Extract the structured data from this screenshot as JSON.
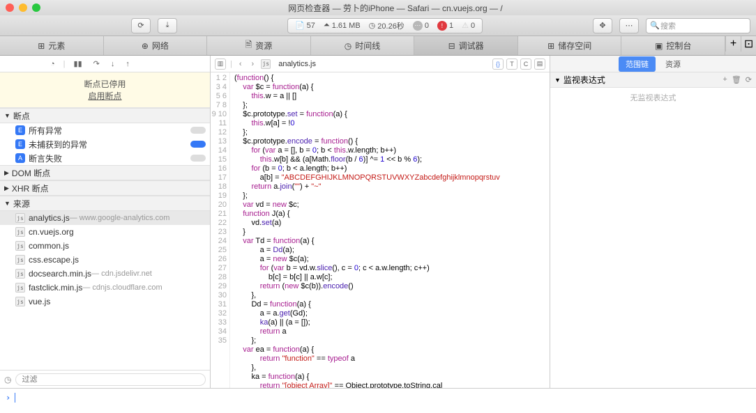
{
  "title": "网页检查器 — 劳卜的iPhone — Safari — cn.vuejs.org — /",
  "toolbar": {
    "files": "57",
    "size": "1.61 MB",
    "time": "20.26秒",
    "msgs": "0",
    "errors": "1",
    "warnings": "0",
    "search_ph": "搜索"
  },
  "tabs": [
    "元素",
    "网络",
    "资源",
    "时间线",
    "调试器",
    "储存空间",
    "控制台"
  ],
  "left": {
    "notice_title": "断点已停用",
    "notice_link": "启用断点",
    "sections": {
      "breakpoints": "断点",
      "dom": "DOM 断点",
      "xhr": "XHR 断点",
      "sources": "来源"
    },
    "bp_rows": [
      "所有异常",
      "未捕获到的异常",
      "断言失败"
    ],
    "sources": [
      {
        "name": "analytics.js",
        "host": " — www.google-analytics.com"
      },
      {
        "name": "cn.vuejs.org",
        "host": ""
      },
      {
        "name": "common.js",
        "host": ""
      },
      {
        "name": "css.escape.js",
        "host": ""
      },
      {
        "name": "docsearch.min.js",
        "host": " — cdn.jsdelivr.net"
      },
      {
        "name": "fastclick.min.js",
        "host": " — cdnjs.cloudflare.com"
      },
      {
        "name": "vue.js",
        "host": ""
      }
    ],
    "filter_ph": "过滤"
  },
  "mid": {
    "file": "analytics.js",
    "lines": 35
  },
  "code": {
    "l1a": "(",
    "l1b": "function",
    "l1c": "() {",
    "l2a": "    ",
    "l2b": "var",
    "l2c": " $c = ",
    "l2d": "function",
    "l2e": "(a) {",
    "l3a": "        ",
    "l3b": "this",
    "l3c": ".w = a || []",
    "l4": "    };",
    "l5a": "    $c.prototype.",
    "l5b": "set",
    "l5c": " = ",
    "l5d": "function",
    "l5e": "(a) {",
    "l6a": "        ",
    "l6b": "this",
    "l6c": ".w[a] = !",
    "l6d": "0",
    "l7": "    };",
    "l8a": "    $c.prototype.",
    "l8b": "encode",
    "l8c": " = ",
    "l8d": "function",
    "l8e": "() {",
    "l9a": "        ",
    "l9b": "for",
    "l9c": " (",
    "l9d": "var",
    "l9e": " a = [], b = ",
    "l9f": "0",
    "l9g": "; b < ",
    "l9h": "this",
    "l9i": ".w.length; b++)",
    "l10a": "            ",
    "l10b": "this",
    "l10c": ".w[b] && (a[Math.",
    "l10d": "floor",
    "l10e": "(b / ",
    "l10f": "6",
    "l10g": ")] ^= ",
    "l10h": "1",
    "l10i": " << b % ",
    "l10j": "6",
    "l10k": ");",
    "l11a": "        ",
    "l11b": "for",
    "l11c": " (b = ",
    "l11d": "0",
    "l11e": "; b < a.length; b++)",
    "l12a": "            a[b] = ",
    "l12b": "\"ABCDEFGHIJKLMNOPQRSTUVWXYZabcdefghijklmnopqrstuv",
    "l13a": "        ",
    "l13b": "return",
    "l13c": " a.",
    "l13d": "join",
    "l13e": "(",
    "l13f": "\"\"",
    "l13g": ") + ",
    "l13h": "\"~\"",
    "l14": "    };",
    "l15a": "    ",
    "l15b": "var",
    "l15c": " vd = ",
    "l15d": "new",
    "l15e": " $c;",
    "l16a": "    ",
    "l16b": "function",
    "l16c": " J(a) {",
    "l17a": "        vd.",
    "l17b": "set",
    "l17c": "(a)",
    "l18": "    }",
    "l19a": "    ",
    "l19b": "var",
    "l19c": " Td = ",
    "l19d": "function",
    "l19e": "(a) {",
    "l20a": "            a = ",
    "l20b": "Dd",
    "l20c": "(a);",
    "l21a": "            a = ",
    "l21b": "new",
    "l21c": " $c(a);",
    "l22a": "            ",
    "l22b": "for",
    "l22c": " (",
    "l22d": "var",
    "l22e": " b = vd.w.",
    "l22f": "slice",
    "l22g": "(), c = ",
    "l22h": "0",
    "l22i": "; c < a.w.length; c++)",
    "l23": "                b[c] = b[c] || a.w[c];",
    "l24a": "            ",
    "l24b": "return",
    "l24c": " (",
    "l24d": "new",
    "l24e": " $c(b)).",
    "l24f": "encode",
    "l24g": "()",
    "l25": "        },",
    "l26a": "        Dd = ",
    "l26b": "function",
    "l26c": "(a) {",
    "l27a": "            a = a.",
    "l27b": "get",
    "l27c": "(Gd);",
    "l28a": "            ",
    "l28b": "ka",
    "l28c": "(a) || (a = []);",
    "l29a": "            ",
    "l29b": "return",
    "l29c": " a",
    "l30": "        };",
    "l31a": "    ",
    "l31b": "var",
    "l31c": " ea = ",
    "l31d": "function",
    "l31e": "(a) {",
    "l32a": "            ",
    "l32b": "return",
    "l32c": " ",
    "l32d": "\"function\"",
    "l32e": " == ",
    "l32f": "typeof",
    "l32g": " a",
    "l33": "        },",
    "l34a": "        ka = ",
    "l34b": "function",
    "l34c": "(a) {",
    "l35a": "            ",
    "l35b": "return",
    "l35c": " ",
    "l35d": "\"[object Array]\"",
    "l35e": " == Object.prototype.toString.cal"
  },
  "right": {
    "tabs": [
      "范围链",
      "资源"
    ],
    "watch_hdr": "监视表达式",
    "watch_empty": "无监视表达式"
  }
}
